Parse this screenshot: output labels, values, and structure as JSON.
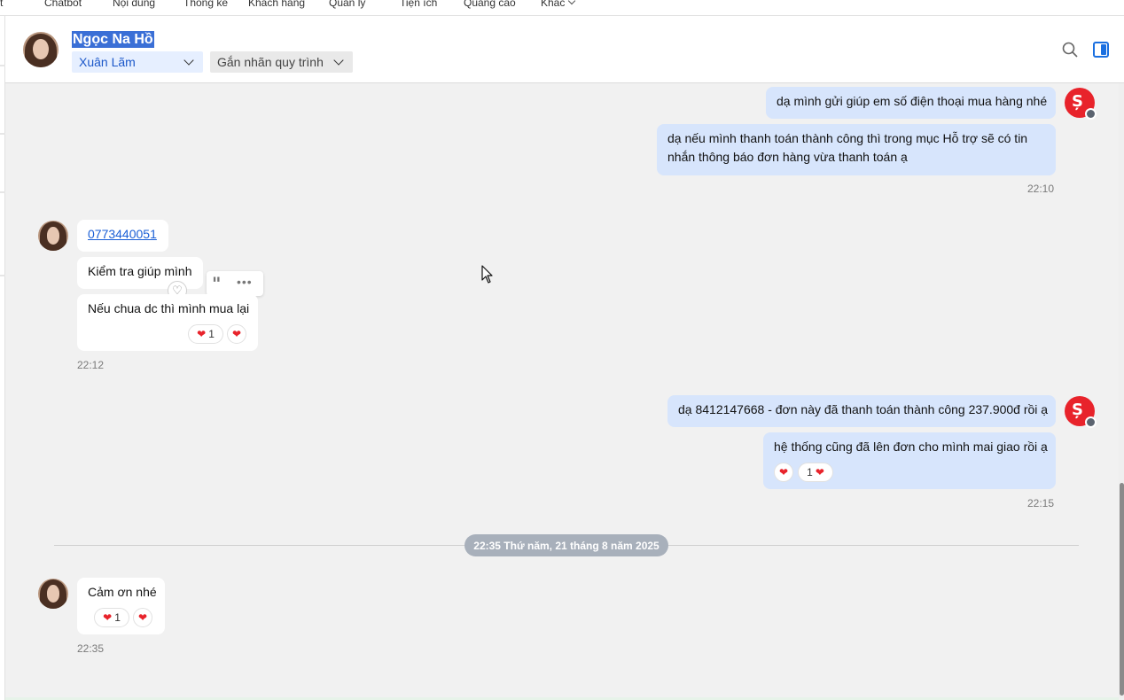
{
  "topnav": {
    "items": [
      {
        "label": "t"
      },
      {
        "label": "Chatbot"
      },
      {
        "label": "Nội dung"
      },
      {
        "label": "Thống kê"
      },
      {
        "label": "Khách hàng"
      },
      {
        "label": "Quản lý"
      },
      {
        "label": "Tiện ích"
      },
      {
        "label": "Quảng cáo"
      },
      {
        "label": "Khác"
      }
    ]
  },
  "header": {
    "contact_name": "Ngọc Na Hồ",
    "assignee": "Xuân Lãm",
    "tag_placeholder": "Gắn nhãn quy trình"
  },
  "messages": {
    "m1": "dạ mình gửi giúp em số điện thoại mua hàng nhé",
    "m2_line1": "dạ nếu mình thanh toán thành công thì trong mục Hỗ trợ sẽ có tin",
    "m2_line2": "nhắn thông báo đơn hàng vừa thanh toán ạ",
    "t1": "22:10",
    "m3": "0773440051",
    "m4": "Kiểm tra giúp mình",
    "m5": "Nếu chua dc thì mình mua lại",
    "m5_react_count": "1",
    "t2": "22:12",
    "m6": "dạ 8412147668 - đơn này đã thanh toán thành công 237.900đ rồi ạ",
    "m7": "hệ thống cũng đã lên đơn cho mình mai giao rồi ạ",
    "m7_react_count": "1",
    "t3": "22:15",
    "date_divider": "22:35 Thứ năm, 21 tháng 8 năm 2025",
    "m8": "Cảm ơn nhé",
    "m8_react_count": "1",
    "t4": "22:35"
  },
  "colors": {
    "accent": "#1a6fe0",
    "outgoing_bubble": "#d7e5fc",
    "incoming_bubble": "#ffffff",
    "brand_red": "#e8232b",
    "date_pill": "#a8b0bb"
  },
  "icons": {
    "search": "search-icon",
    "panel": "sidebar-panel-icon",
    "heart": "heart-icon",
    "quote": "quote-icon",
    "more": "more-icon"
  }
}
